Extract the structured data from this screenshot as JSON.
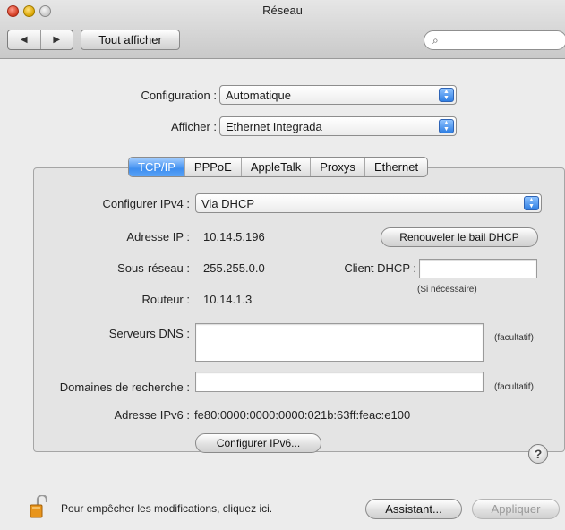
{
  "window": {
    "title": "Réseau",
    "nav_back_icon": "◀",
    "nav_forward_icon": "▶",
    "show_all_label": "Tout afficher",
    "search_placeholder": "",
    "search_icon": "⌕"
  },
  "top_settings": {
    "configuration_label": "Configuration :",
    "configuration_value": "Automatique",
    "afficher_label": "Afficher :",
    "afficher_value": "Ethernet Integrada"
  },
  "tabs": [
    {
      "label": "TCP/IP",
      "active": true
    },
    {
      "label": "PPPoE",
      "active": false
    },
    {
      "label": "AppleTalk",
      "active": false
    },
    {
      "label": "Proxys",
      "active": false
    },
    {
      "label": "Ethernet",
      "active": false
    }
  ],
  "tcpip": {
    "configurer_ipv4_label": "Configurer IPv4 :",
    "configurer_ipv4_value": "Via DHCP",
    "ip_label": "Adresse IP :",
    "ip_value": "10.14.5.196",
    "renew_button": "Renouveler le bail DHCP",
    "subnet_label": "Sous-réseau :",
    "subnet_value": "255.255.0.0",
    "client_dhcp_label": "Client DHCP :",
    "client_dhcp_value": "",
    "client_dhcp_note": "(Si nécessaire)",
    "router_label": "Routeur :",
    "router_value": "10.14.1.3",
    "dns_label": "Serveurs DNS :",
    "dns_value": "",
    "dns_optional": "(facultatif)",
    "search_domains_label": "Domaines de recherche :",
    "search_domains_value": "",
    "search_domains_optional": "(facultatif)",
    "ipv6_label": "Adresse IPv6 :",
    "ipv6_value": "fe80:0000:0000:0000:021b:63ff:feac:e100",
    "configure_ipv6_button": "Configurer IPv6...",
    "help_icon": "?"
  },
  "footer": {
    "lock_text": "Pour empêcher les modifications, cliquez ici.",
    "assistant_button": "Assistant...",
    "apply_button": "Appliquer"
  },
  "colors": {
    "accent_blue": "#3d8ef0",
    "lock_orange": "#e8951c"
  }
}
